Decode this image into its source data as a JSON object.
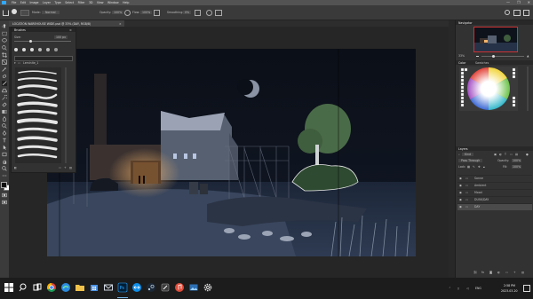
{
  "menu": [
    "File",
    "Edit",
    "Image",
    "Layer",
    "Type",
    "Select",
    "Filter",
    "3D",
    "View",
    "Window",
    "Help"
  ],
  "window_buttons": [
    "—",
    "❐",
    "✕"
  ],
  "options_bar": {
    "mode_label": "Mode:",
    "mode_value": "Normal",
    "opacity_label": "Opacity:",
    "opacity_value": "100%",
    "flow_label": "Flow:",
    "flow_value": "100%",
    "smoothing_label": "Smoothing:",
    "smoothing_value": "0%"
  },
  "document_tab": "LOCATION WAREHOUSE WIDE.psd @ 33% (DAY, RGB/8)",
  "brush_panel": {
    "title": "Brushes",
    "size_label": "Size:",
    "size_value": "100 px",
    "folder_label": "Leminite_1"
  },
  "right_panel": {
    "navigator_title": "Navigator",
    "zoom_value": "33%",
    "color_title": "Color",
    "swatches_title": "Swatches",
    "layers_title": "Layers",
    "kind_label": "Kind",
    "blend_mode": "Pass Through",
    "opacity_label": "Opacity:",
    "opacity_value": "100%",
    "lock_label": "Lock:",
    "fill_label": "Fill:",
    "fill_value": "100%",
    "layers": [
      "Sonne",
      "Ambient",
      "Mood",
      "DUSK/DAY",
      "DAY"
    ]
  },
  "taskbar": {
    "time": "2:58 PM",
    "date": "2023-03-20",
    "apps": [
      "start-icon",
      "search-icon",
      "task-view-icon",
      "folder-icon",
      "chrome-icon",
      "edge-icon",
      "email-icon",
      "store-icon",
      "photoshop-icon",
      "teamviewer-icon",
      "steam-icon",
      "wacom-icon",
      "music-icon",
      "photos-icon",
      "settings-icon"
    ]
  },
  "colors": {
    "ui_dark": "#323232",
    "ui_darker": "#282828",
    "photoshop_blue": "#31a8ff",
    "night_sky": "#0c1018",
    "warm_light": "#f2b36a"
  }
}
